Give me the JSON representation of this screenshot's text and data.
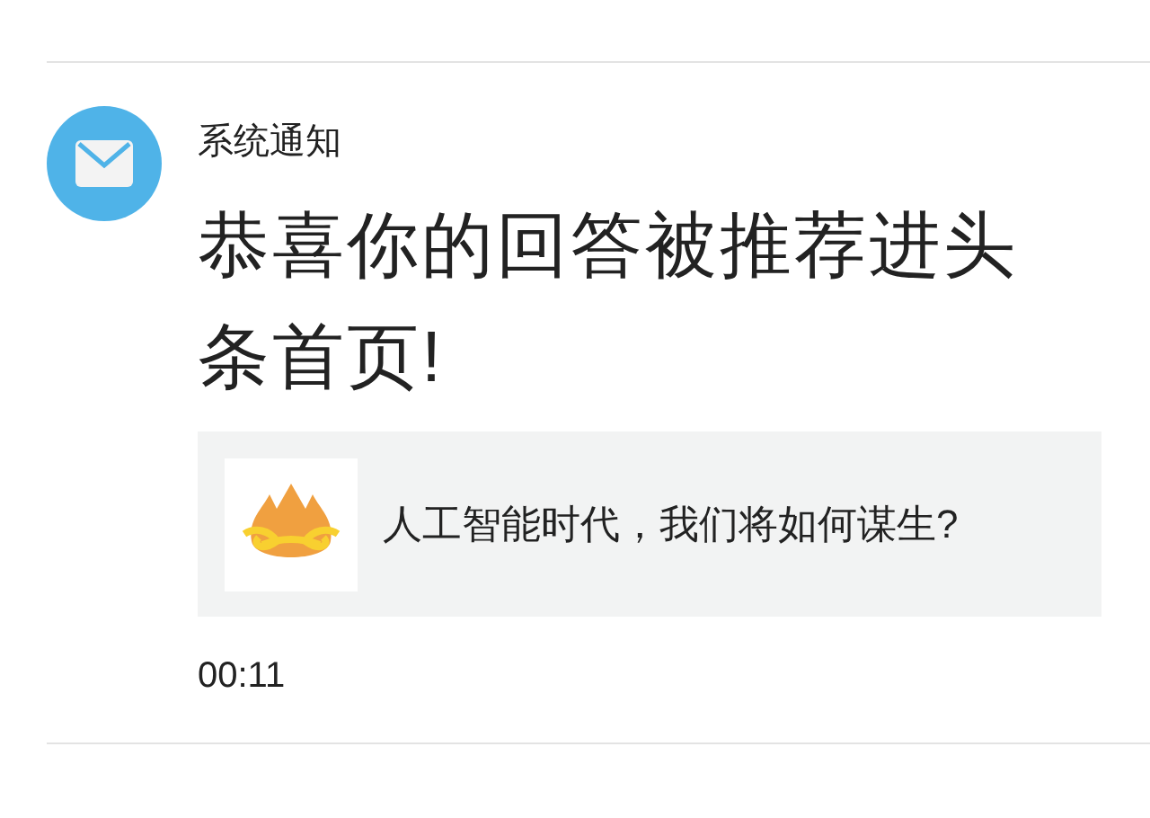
{
  "notification": {
    "sender": "系统通知",
    "message": "恭喜你的回答被推荐进头条首页!",
    "card": {
      "title": "人工智能时代，我们将如何谋生?"
    },
    "time": "00:11"
  }
}
